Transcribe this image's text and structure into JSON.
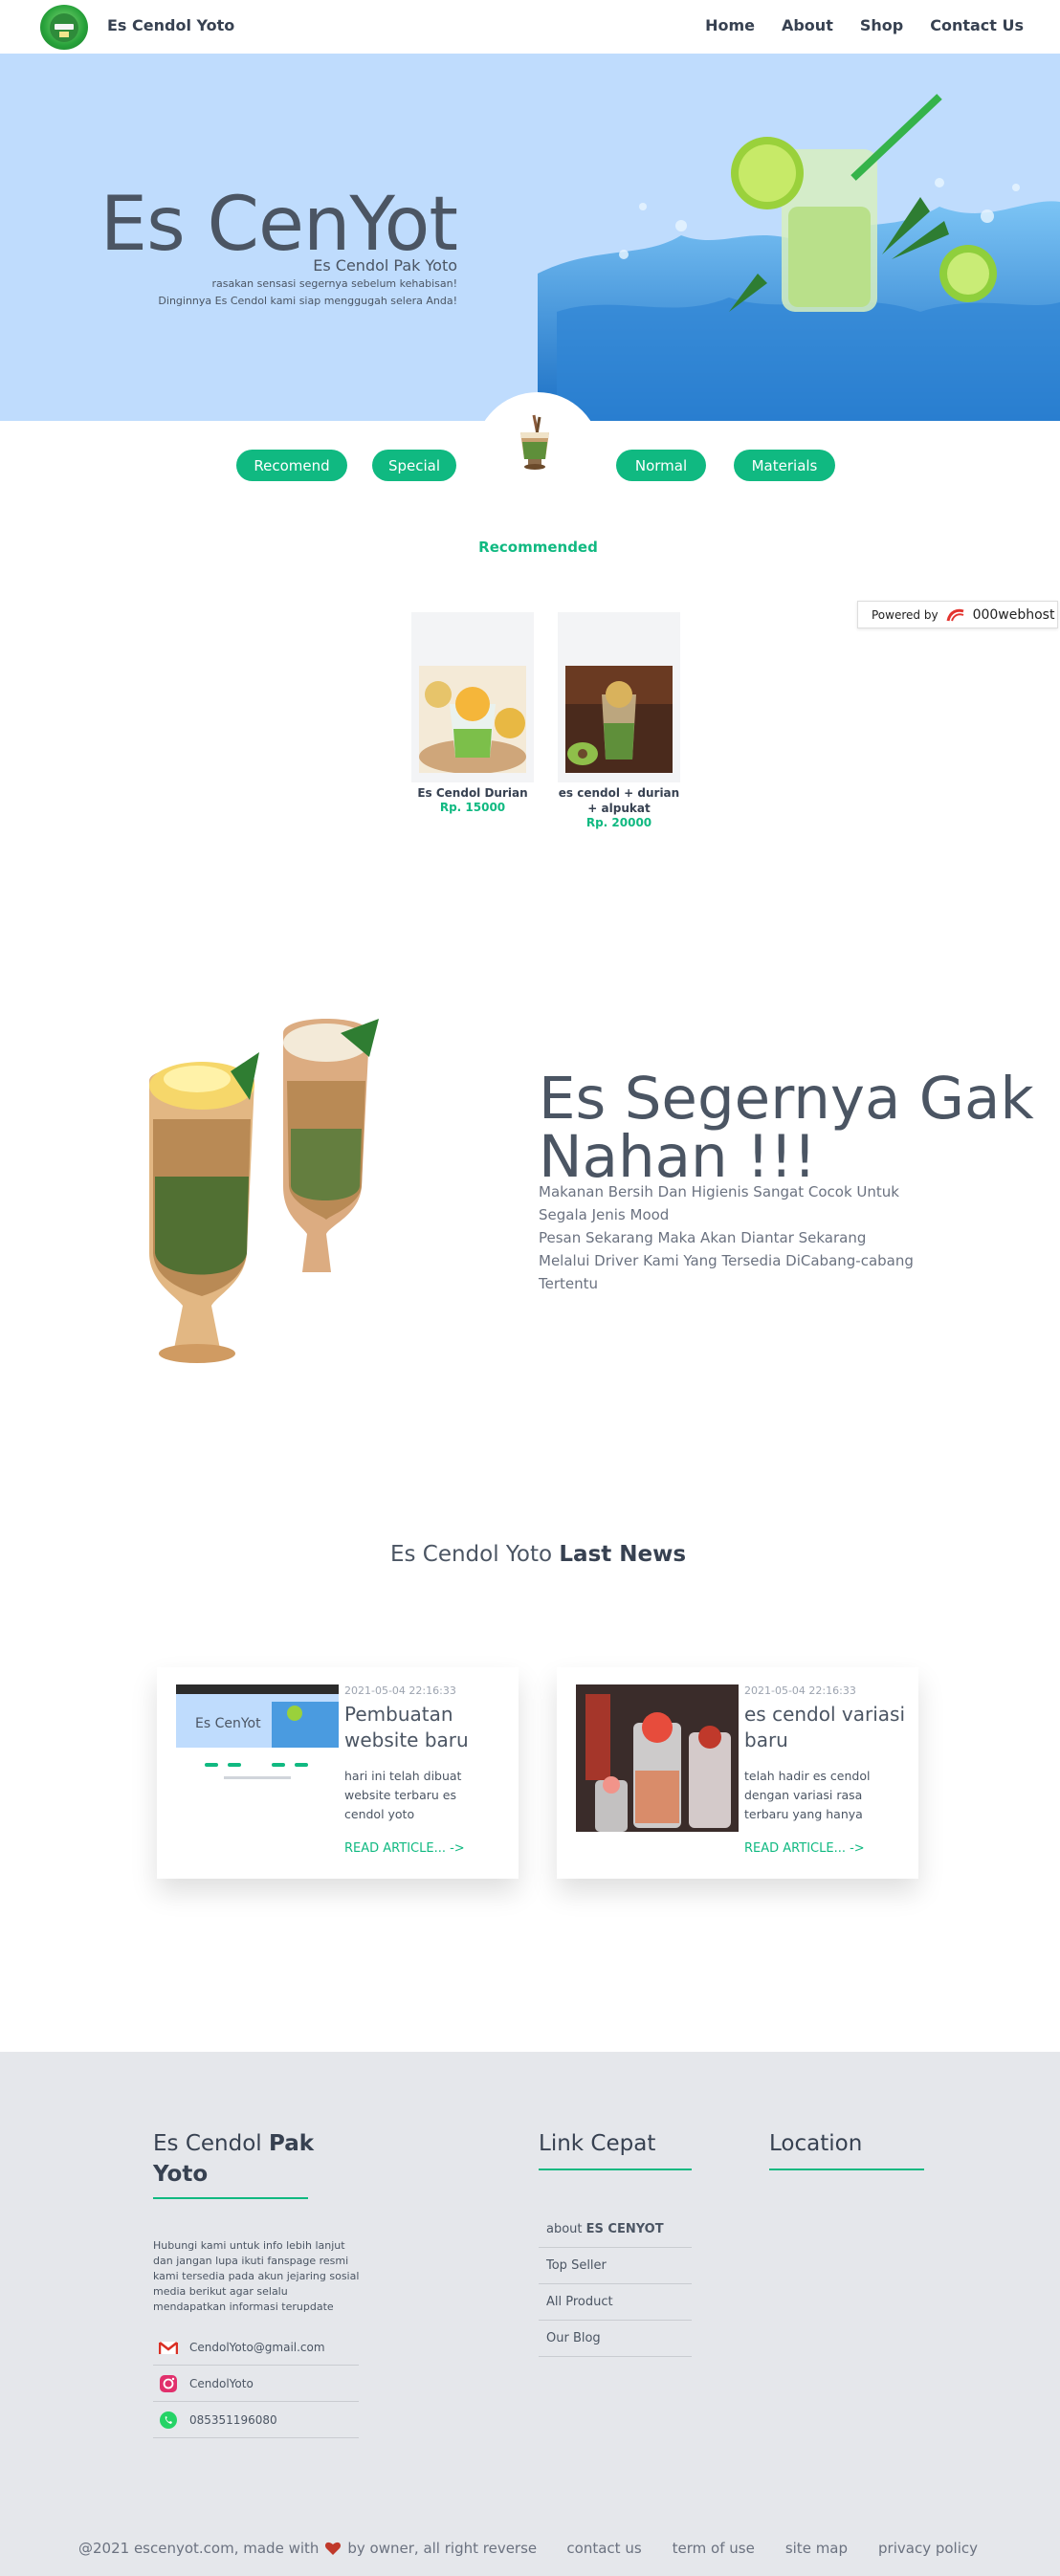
{
  "nav": {
    "brand": "Es Cendol Yoto",
    "logo_icon": "es-cendol-logo",
    "items": [
      {
        "label": "Home"
      },
      {
        "label": "About"
      },
      {
        "label": "Shop"
      },
      {
        "label": "Contact Us"
      }
    ]
  },
  "hero": {
    "title": "Es CenYot",
    "subtitle": "Es Cendol Pak Yoto",
    "line1": "rasakan sensasi segernya sebelum kehabisan!",
    "line2": "Dinginnya Es Cendol kami siap menggugah selera Anda!",
    "background_color": "#bfdcfd"
  },
  "tabs": [
    {
      "label": "Recomend"
    },
    {
      "label": "Special"
    },
    {
      "label": "Normal"
    },
    {
      "label": "Materials"
    }
  ],
  "accent_color": "#10b981",
  "section_label": "Recommended",
  "powered": {
    "prefix": "Powered by",
    "name": "000webhost"
  },
  "products": [
    {
      "name": "Es Cendol Durian",
      "price": "Rp. 15000"
    },
    {
      "name": "es cendol + durian + alpukat",
      "price": "Rp. 20000"
    }
  ],
  "feature": {
    "title": "Es Segernya Gak Nahan !!!",
    "line1": "Makanan Bersih Dan Higienis Sangat Cocok Untuk Segala Jenis Mood",
    "line2": "Pesan Sekarang Maka Akan Diantar Sekarang Melalui Driver Kami Yang Tersedia DiCabang-cabang Tertentu"
  },
  "news": {
    "heading_prefix": "Es Cendol Yoto",
    "heading_bold": "Last News",
    "articles": [
      {
        "date": "2021-05-04 22:16:33",
        "title": "Pembuatan website baru",
        "desc": "hari ini telah dibuat website terbaru es cendol yoto",
        "link": "READ ARTICLE... ->"
      },
      {
        "date": "2021-05-04 22:16:33",
        "title": "es cendol variasi baru",
        "desc": "telah hadir es cendol dengan variasi rasa terbaru yang hanya",
        "link": "READ ARTICLE... ->"
      }
    ]
  },
  "footer": {
    "title_prefix": "Es Cendol",
    "title_bold": "Pak Yoto",
    "about": "Hubungi kami untuk info lebih lanjut dan jangan lupa ikuti fanspage resmi kami tersedia pada akun jejaring sosial media berikut agar selalu mendapatkan informasi terupdate",
    "contacts": [
      {
        "icon": "gmail-icon",
        "text": "CendolYoto@gmail.com"
      },
      {
        "icon": "instagram-icon",
        "text": "CendolYoto"
      },
      {
        "icon": "whatsapp-icon",
        "text": "085351196080"
      }
    ],
    "links_title": "Link Cepat",
    "links": [
      {
        "prefix": "about",
        "bold": "ES CENYOT"
      },
      {
        "prefix": "Top Seller",
        "bold": ""
      },
      {
        "prefix": "All Product",
        "bold": ""
      },
      {
        "prefix": "Our Blog",
        "bold": ""
      }
    ],
    "location_title": "Location",
    "copyright_prefix": "@2021 escenyot.com, made with",
    "copyright_suffix": "by owner, all right reverse",
    "bottom_links": [
      "contact us",
      "term of use",
      "site map",
      "privacy policy"
    ]
  }
}
